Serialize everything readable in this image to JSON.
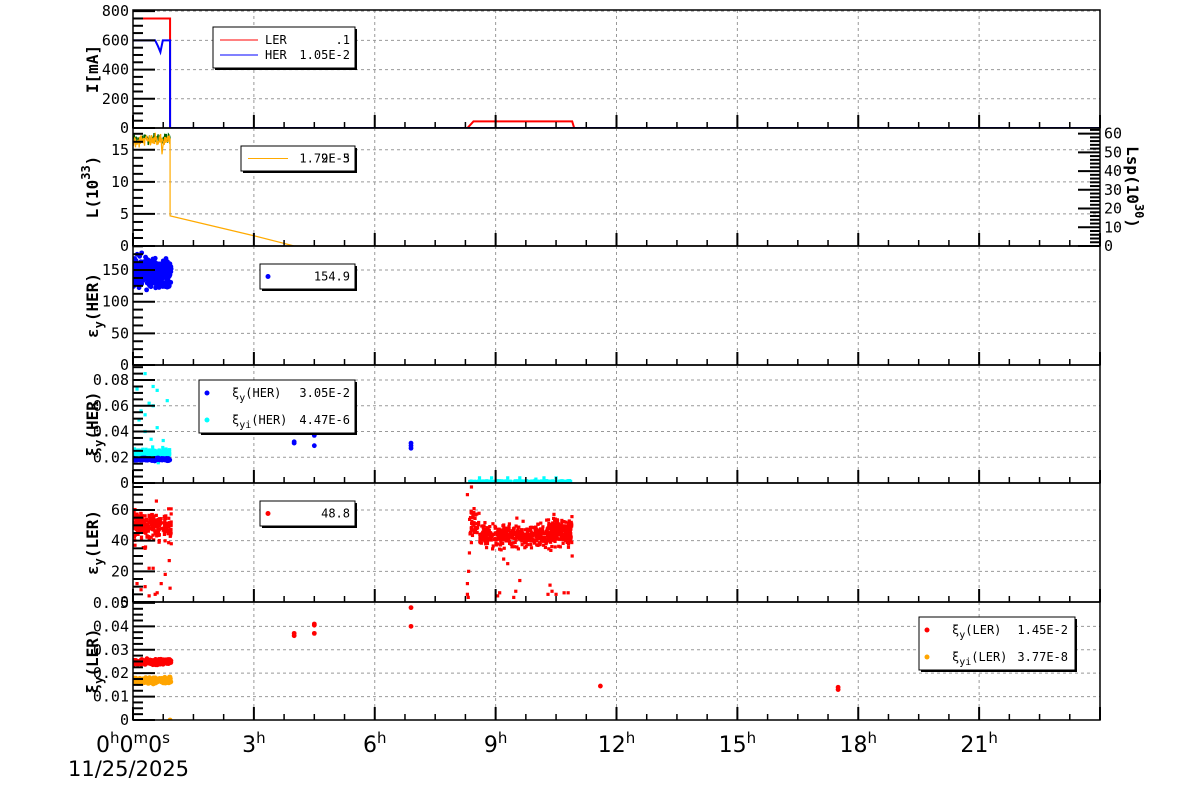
{
  "chart_data": {
    "type": "line+scatter",
    "title": "",
    "x_unit": "hours",
    "xlim": [
      0,
      24
    ],
    "x_ticks": [
      {
        "value": 0,
        "label": "0",
        "sup": "h",
        "label2": "0",
        "sup2": "m",
        "label3": "0",
        "sup3": "s"
      },
      {
        "value": 3,
        "label": "3",
        "sup": "h"
      },
      {
        "value": 6,
        "label": "6",
        "sup": "h"
      },
      {
        "value": 9,
        "label": "9",
        "sup": "h"
      },
      {
        "value": 12,
        "label": "12",
        "sup": "h"
      },
      {
        "value": 15,
        "label": "15",
        "sup": "h"
      },
      {
        "value": 18,
        "label": "18",
        "sup": "h"
      },
      {
        "value": 21,
        "label": "21",
        "sup": "h"
      }
    ],
    "date": "11/25/2025",
    "grid": true,
    "panels": [
      {
        "ylabel": {
          "pre": "I[mA]",
          "sub": "",
          "sup": "",
          "post": ""
        },
        "ylim": [
          0,
          808
        ],
        "yticks": [
          0,
          200,
          400,
          600,
          800
        ],
        "ytick_labels": [
          "0",
          "200",
          "400",
          "600",
          "800"
        ],
        "legend": [
          {
            "marker": "line",
            "color": "#ff0000",
            "pre": "LER",
            "sub": "",
            "value": ".1"
          },
          {
            "marker": "line",
            "color": "#0000ff",
            "pre": "HER",
            "sub": "",
            "value": "1.05E-2"
          }
        ],
        "series": [
          {
            "name": "LER",
            "kind": "line",
            "color": "#ff0000",
            "points": [
              [
                0,
                750
              ],
              [
                0.92,
                750
              ],
              [
                0.92,
                0
              ],
              [
                8.3,
                0
              ],
              [
                8.45,
                45
              ],
              [
                10.9,
                45
              ],
              [
                10.95,
                0
              ],
              [
                24,
                0
              ]
            ]
          },
          {
            "name": "HER",
            "kind": "line",
            "color": "#0000ff",
            "points": [
              [
                0,
                600
              ],
              [
                0.55,
                600
              ],
              [
                0.62,
                560
              ],
              [
                0.68,
                520
              ],
              [
                0.74,
                600
              ],
              [
                0.92,
                600
              ],
              [
                0.92,
                0
              ],
              [
                24,
                0
              ]
            ]
          }
        ]
      },
      {
        "ylabel": {
          "pre": "L(10",
          "sub": "",
          "sup": "33",
          "post": ")"
        },
        "ylim": [
          0,
          18.4
        ],
        "yticks": [
          0,
          5,
          10,
          15
        ],
        "ytick_labels": [
          "0",
          "5",
          "10",
          "15"
        ],
        "right_axis": {
          "label_pre": "Lsp(10",
          "label_sup": "30",
          "label_post": ")",
          "ylim": [
            0,
            63
          ],
          "yticks": [
            0,
            10,
            20,
            30,
            40,
            50,
            60
          ],
          "ytick_labels": [
            "0",
            "10",
            "20",
            "30",
            "40",
            "50",
            "60"
          ]
        },
        "legend": [
          {
            "marker": "line",
            "color": "#ffaa00",
            "pre": "",
            "sub": "",
            "value": "1.79E-3",
            "value_overlap": "2E-5"
          }
        ],
        "series": [
          {
            "name": "Lsp",
            "kind": "noise",
            "color": "#006400",
            "x": [
              0,
              0.92
            ],
            "y": 16.8,
            "spread": 0.4
          },
          {
            "name": "L",
            "kind": "noise",
            "color": "#ffaa00",
            "x": [
              0,
              0.92
            ],
            "y": 16.4,
            "spread": 0.5
          },
          {
            "name": "L-tail",
            "kind": "line",
            "color": "#ffaa00",
            "points": [
              [
                0.7,
                16.4
              ],
              [
                0.72,
                14.3
              ],
              [
                0.75,
                16
              ],
              [
                0.92,
                16.5
              ],
              [
                0.92,
                4.7
              ],
              [
                3,
                1.6
              ],
              [
                4,
                0
              ],
              [
                17.5,
                0
              ]
            ]
          }
        ]
      },
      {
        "ylabel": {
          "pre": "ε",
          "sub": "y",
          "sup": "",
          "post": "(HER)"
        },
        "ylim": [
          0,
          188
        ],
        "yticks": [
          0,
          50,
          100,
          150
        ],
        "ytick_labels": [
          "0",
          "50",
          "100",
          "150"
        ],
        "legend": [
          {
            "marker": "dot",
            "color": "#0000ff",
            "pre": "",
            "sub": "",
            "value": "154.9"
          }
        ],
        "series": [
          {
            "name": "εy(HER)",
            "kind": "scatter",
            "color": "#0000ff",
            "shape": "circle",
            "clusters": [
              {
                "x": [
                  0,
                  0.95
                ],
                "y": 145,
                "spread": 10,
                "n": 420
              }
            ],
            "points": []
          }
        ]
      },
      {
        "ylabel": {
          "pre": "ξ",
          "sub": "y",
          "sup": "",
          "post": "(HER)"
        },
        "ylim": [
          0,
          0.0917
        ],
        "yticks": [
          0,
          0.02,
          0.04,
          0.06,
          0.08
        ],
        "ytick_labels": [
          "0",
          "0.02",
          "0.04",
          "0.06",
          "0.08"
        ],
        "legend": [
          {
            "marker": "dot",
            "color": "#0000ff",
            "pre": "ξ",
            "sub": "y",
            "post": "(HER)",
            "value": "3.05E-2"
          },
          {
            "marker": "dot",
            "color": "#00ffff",
            "pre": "ξ",
            "sub": "yi",
            "post": "(HER)",
            "value": "4.47E-6"
          }
        ],
        "series": [
          {
            "name": "ξyi(HER)",
            "kind": "scatter",
            "color": "#00ffff",
            "shape": "square",
            "clusters": [
              {
                "x": [
                  0,
                  0.92
                ],
                "y": 0.023,
                "spread": 0.0018,
                "n": 220
              },
              {
                "x": [
                  8.35,
                  10.9
                ],
                "y": 0.0012,
                "spread": 0.0003,
                "n": 160
              }
            ],
            "points": [
              [
                0.3,
                0.085
              ],
              [
                0.5,
                0.075
              ],
              [
                0.1,
                0.073
              ],
              [
                0.6,
                0.072
              ],
              [
                0.2,
                0.056
              ],
              [
                0.3,
                0.053
              ],
              [
                0.4,
                0.062
              ],
              [
                0.85,
                0.064
              ],
              [
                0.15,
                0.049
              ],
              [
                0.5,
                0.06
              ],
              [
                0.3,
                0.04
              ],
              [
                0.6,
                0.043
              ],
              [
                0.45,
                0.034
              ],
              [
                0.75,
                0.033
              ],
              [
                8.6,
                0.004
              ],
              [
                8.9,
                0.004
              ],
              [
                9.3,
                0.004
              ],
              [
                9.6,
                0.004
              ],
              [
                10.2,
                0.004
              ],
              [
                10.5,
                0.004
              ],
              [
                10.0,
                0.003
              ]
            ]
          },
          {
            "name": "ξy(HER)",
            "kind": "scatter",
            "color": "#0000ff",
            "shape": "circle",
            "clusters": [
              {
                "x": [
                  0,
                  0.92
                ],
                "y": 0.0185,
                "spread": 0.0004,
                "n": 160
              }
            ],
            "points": [
              [
                4.0,
                0.031
              ],
              [
                4.0,
                0.032
              ],
              [
                4.5,
                0.037
              ],
              [
                4.5,
                0.029
              ],
              [
                6.9,
                0.031
              ],
              [
                6.9,
                0.029
              ],
              [
                6.9,
                0.027
              ]
            ]
          }
        ]
      },
      {
        "ylabel": {
          "pre": "ε",
          "sub": "y",
          "sup": "",
          "post": "(LER)"
        },
        "ylim": [
          0,
          77.6
        ],
        "yticks": [
          0,
          20,
          40,
          60
        ],
        "ytick_labels": [
          "0",
          "20",
          "40",
          "60"
        ],
        "legend": [
          {
            "marker": "dot",
            "color": "#ff0000",
            "pre": "",
            "sub": "",
            "value": "48.8"
          }
        ],
        "series": [
          {
            "name": "εy(LER)",
            "kind": "scatter",
            "color": "#ff0000",
            "shape": "square",
            "clusters": [
              {
                "x": [
                  0,
                  0.95
                ],
                "y": 50,
                "spread": 4.5,
                "n": 260
              },
              {
                "x": [
                  8.6,
                  10.9
                ],
                "y": 43,
                "spread": 3.5,
                "n": 520
              },
              {
                "x": [
                  8.35,
                  8.6
                ],
                "y": 52,
                "spread": 5,
                "n": 40
              },
              {
                "x": [
                  10.3,
                  10.9
                ],
                "y": 49,
                "spread": 3,
                "n": 80
              }
            ],
            "points": [
              [
                0.1,
                12
              ],
              [
                0.3,
                10
              ],
              [
                0.4,
                22
              ],
              [
                0.5,
                22
              ],
              [
                0.6,
                6
              ],
              [
                0.2,
                8
              ],
              [
                0.9,
                27
              ],
              [
                0.8,
                18
              ],
              [
                0.7,
                12
              ],
              [
                0.4,
                4
              ],
              [
                0.55,
                5
              ],
              [
                0.95,
                38
              ],
              [
                0.05,
                37
              ],
              [
                0.3,
                35
              ],
              [
                0.92,
                9
              ],
              [
                8.3,
                5
              ],
              [
                8.32,
                3
              ],
              [
                8.3,
                12
              ],
              [
                8.33,
                20
              ],
              [
                8.35,
                32
              ],
              [
                8.4,
                58
              ],
              [
                8.3,
                70
              ],
              [
                8.4,
                75
              ],
              [
                9.05,
                4
              ],
              [
                9.1,
                6
              ],
              [
                9.45,
                3
              ],
              [
                9.5,
                7
              ],
              [
                10.3,
                5
              ],
              [
                10.35,
                11
              ],
              [
                10.4,
                7
              ],
              [
                10.5,
                5
              ],
              [
                10.7,
                6
              ],
              [
                10.8,
                6
              ],
              [
                10.9,
                30
              ],
              [
                9.6,
                14
              ],
              [
                9.3,
                25
              ],
              [
                9.2,
                28
              ]
            ]
          }
        ]
      },
      {
        "ylabel": {
          "pre": "ξ",
          "sub": "y",
          "sup": "",
          "post": "(LER)"
        },
        "ylim": [
          0,
          0.0504
        ],
        "yticks": [
          0,
          0.01,
          0.02,
          0.03,
          0.04,
          0.05
        ],
        "ytick_labels": [
          "0",
          "0.01",
          "0.02",
          "0.03",
          "0.04",
          "0.05"
        ],
        "legend": [
          {
            "marker": "dot",
            "color": "#ff0000",
            "pre": "ξ",
            "sub": "y",
            "post": "(LER)",
            "value": "1.45E-2"
          },
          {
            "marker": "dot",
            "color": "#ffa500",
            "pre": "ξ",
            "sub": "yi",
            "post": "(LER)",
            "value": "3.77E-8"
          }
        ],
        "series": [
          {
            "name": "ξy(LER)",
            "kind": "scatter",
            "color": "#ff0000",
            "shape": "circle",
            "clusters": [
              {
                "x": [
                  0,
                  0.95
                ],
                "y": 0.0248,
                "spread": 0.0005,
                "n": 200
              }
            ],
            "points": [
              [
                4.0,
                0.036
              ],
              [
                4.0,
                0.037
              ],
              [
                4.5,
                0.041
              ],
              [
                4.5,
                0.0405
              ],
              [
                4.5,
                0.037
              ],
              [
                6.9,
                0.048
              ],
              [
                6.9,
                0.04
              ],
              [
                11.6,
                0.0145
              ],
              [
                17.5,
                0.013
              ],
              [
                17.5,
                0.014
              ]
            ]
          },
          {
            "name": "ξyi(LER)",
            "kind": "scatter",
            "color": "#ffa500",
            "shape": "circle",
            "clusters": [
              {
                "x": [
                  0,
                  0.95
                ],
                "y": 0.0168,
                "spread": 0.0006,
                "n": 200
              }
            ],
            "points": [
              [
                0.92,
                0.0
              ]
            ]
          }
        ]
      }
    ]
  }
}
